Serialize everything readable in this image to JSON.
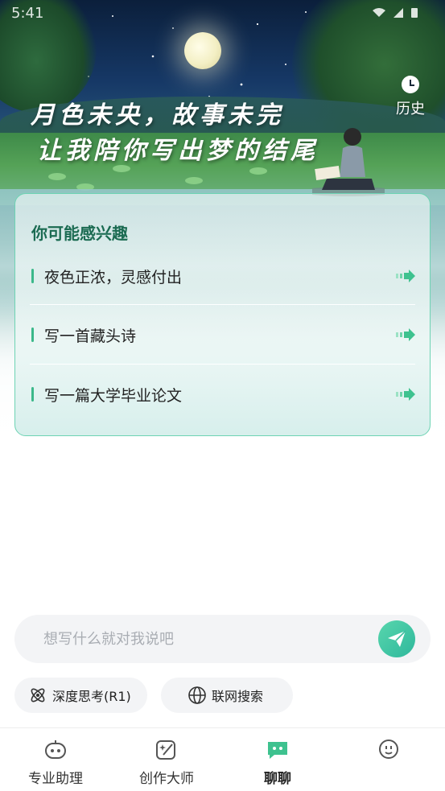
{
  "status_bar": {
    "time": "5:41"
  },
  "hero": {
    "title_line1": "月色未央，故事未完",
    "title_line2": "让我陪你写出梦的结尾",
    "history_label": "历史"
  },
  "suggestions": {
    "title": "你可能感兴趣",
    "items": [
      {
        "label": "夜色正浓，灵感付出"
      },
      {
        "label": "写一首藏头诗"
      },
      {
        "label": "写一篇大学毕业论文"
      }
    ]
  },
  "composer": {
    "placeholder": "想写什么就对我说吧",
    "value": "",
    "deep_think_label": "深度思考(R1)",
    "web_search_label": "联网搜索"
  },
  "nav": {
    "items": [
      {
        "label": "专业助理",
        "icon": "robot-face-icon"
      },
      {
        "label": "创作大师",
        "icon": "edit-sparkle-icon"
      },
      {
        "label": "聊聊",
        "icon": "chat-bubble-icon",
        "active": true
      },
      {
        "label": "",
        "icon": "smiley-icon"
      }
    ]
  },
  "colors": {
    "accent": "#3bb88a",
    "card_border": "#6dd3b3",
    "title_green": "#1b6b52"
  }
}
